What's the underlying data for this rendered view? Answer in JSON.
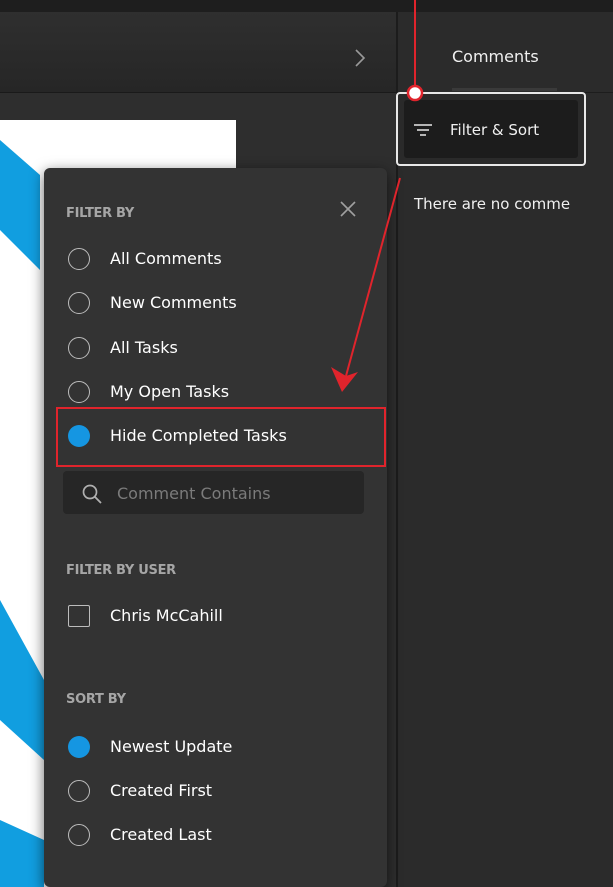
{
  "header": {
    "comments_tab": "Comments"
  },
  "filter_button": {
    "label": "Filter & Sort"
  },
  "comments": {
    "empty_text": "There are no comme"
  },
  "panel": {
    "filter_by_heading": "FILTER BY",
    "filter_options": [
      {
        "label": "All Comments",
        "selected": false
      },
      {
        "label": "New Comments",
        "selected": false
      },
      {
        "label": "All Tasks",
        "selected": false
      },
      {
        "label": "My Open Tasks",
        "selected": false
      },
      {
        "label": "Hide Completed Tasks",
        "selected": true
      }
    ],
    "search_placeholder": "Comment Contains",
    "filter_by_user_heading": "FILTER BY USER",
    "users": [
      {
        "label": "Chris McCahill",
        "checked": false
      }
    ],
    "sort_by_heading": "SORT BY",
    "sort_options": [
      {
        "label": "Newest Update",
        "selected": true
      },
      {
        "label": "Created First",
        "selected": false
      },
      {
        "label": "Created Last",
        "selected": false
      }
    ]
  },
  "colors": {
    "accent": "#1596e2",
    "annotation": "#e0242c",
    "panel_bg": "#333333",
    "canvas_shape": "#119ee0"
  },
  "icons": [
    "chevron-right-icon",
    "filter-lines-icon",
    "close-icon",
    "search-icon"
  ]
}
